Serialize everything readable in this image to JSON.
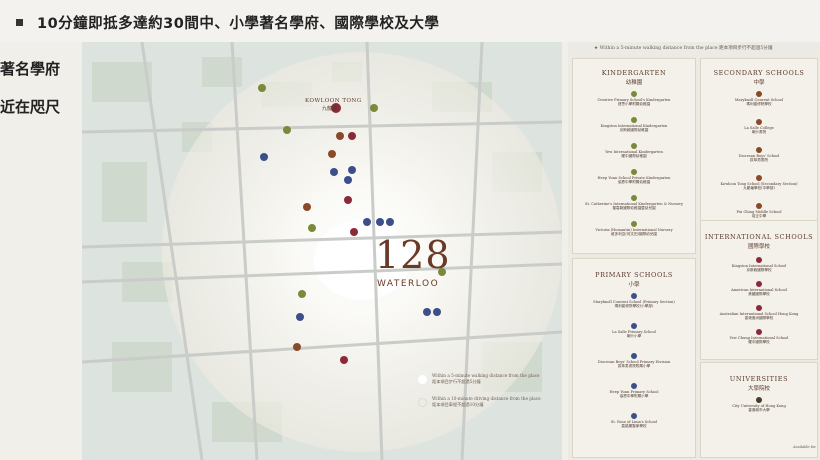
{
  "headline": "10分鐘即抵多達約30間中、小學著名學府、國際學校及大學",
  "side_lines": [
    "著名學府",
    "近在咫尺"
  ],
  "map": {
    "kowloon_tong_en": "KOWLOON TONG",
    "kowloon_tong_zh": "九龍塘",
    "brand_number": "128",
    "brand_name": "WATERLOO",
    "legend": [
      {
        "en": "Within a 5-minute walking distance from the place",
        "zh": "距本項目步行不超過5分鐘"
      },
      {
        "en": "Within a 10-minute driving distance from the place",
        "zh": "距本項目車程不超過10分鐘"
      }
    ],
    "colors": {
      "kindergarten": "#7a8a3a",
      "primary": "#3d4f8a",
      "secondary": "#8a4a2a",
      "international": "#8a2a3a",
      "university": "#4a3a2a"
    }
  },
  "panel": {
    "top_note": "★ Within a 5-minute walking distance from the place  距本項目步行不超過5分鐘",
    "kindergarten": {
      "title": "KINDERGARTEN",
      "title_zh": "幼稚園",
      "items": [
        {
          "en": "Creative Primary School's Kindergarten",
          "zh": "啓思小學附屬幼稚園"
        },
        {
          "en": "Kingston International Kindergarten",
          "zh": "京斯敦國際幼稚園"
        },
        {
          "en": "Yew International Kindergarten",
          "zh": "耀中國際幼稚園"
        },
        {
          "en": "Heep Yunn School Private Kindergarten",
          "zh": "協恩中學附屬幼稚園"
        },
        {
          "en": "St. Catherine's International Kindergarten & Nursery",
          "zh": "聖嘉勒國際幼稚園暨幼兒園"
        },
        {
          "en": "Victoria (Homantin) International Nursery",
          "zh": "維多利亞(何文田)國際幼兒園"
        }
      ]
    },
    "primary": {
      "title": "PRIMARY SCHOOLS",
      "title_zh": "小學",
      "items": [
        {
          "en": "Maryknoll Convent School (Primary Section)",
          "zh": "瑪利諾修院學校(小學部)"
        },
        {
          "en": "La Salle Primary School",
          "zh": "喇沙小學"
        },
        {
          "en": "Diocesan Boys' School Primary Division",
          "zh": "拔萃男書院附屬小學"
        },
        {
          "en": "Heep Yunn Primary School",
          "zh": "協恩中學附屬小學"
        },
        {
          "en": "St. Rose of Lima's School",
          "zh": "嘉諾撒聖家學校"
        }
      ]
    },
    "secondary": {
      "title": "SECONDARY SCHOOLS",
      "title_zh": "中學",
      "items": [
        {
          "en": "Maryknoll Convent School",
          "zh": "瑪利諾修院學校"
        },
        {
          "en": "La Salle College",
          "zh": "喇沙書院"
        },
        {
          "en": "Diocesan Boys' School",
          "zh": "拔萃男書院"
        },
        {
          "en": "Kowloon Tong School (Secondary Section)",
          "zh": "九龍塘學校(中學部)"
        },
        {
          "en": "Pui Ching Middle School",
          "zh": "培正中學"
        }
      ]
    },
    "international": {
      "title": "INTERNATIONAL SCHOOLS",
      "title_zh": "國際學校",
      "items": [
        {
          "en": "Kingston International School",
          "zh": "京斯敦國際學校"
        },
        {
          "en": "American International School",
          "zh": "美國國際學校"
        },
        {
          "en": "Australian International School Hong Kong",
          "zh": "香港澳洲國際學校"
        },
        {
          "en": "Yew Chung International School",
          "zh": "耀中國際學校"
        }
      ]
    },
    "universities": {
      "title": "UNIVERSITIES",
      "title_zh": "大學院校",
      "items": [
        {
          "en": "City University of Hong Kong",
          "zh": "香港城市大學"
        }
      ]
    },
    "footnote": "Available for"
  }
}
